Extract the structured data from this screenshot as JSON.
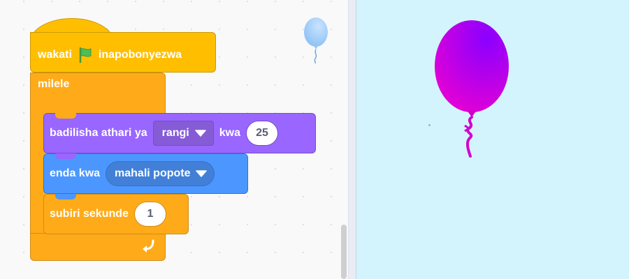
{
  "workspace": {
    "hat_block": {
      "label_before": "wakati",
      "icon": "green-flag-icon",
      "label_after": "inapobonyezwa"
    },
    "forever_block": {
      "label": "milele",
      "loop_icon": "loop-arrow-icon"
    },
    "looks_block": {
      "label_before": "badilisha athari ya",
      "effect": "rangi",
      "label_mid": "kwa",
      "value": "25"
    },
    "motion_block": {
      "label_before": "enda kwa",
      "target": "mahali popote"
    },
    "wait_block": {
      "label_before": "subiri sekunde",
      "value": "1"
    }
  },
  "sprite_thumbnail": {
    "icon": "balloon-icon"
  },
  "stage": {
    "sprite": "balloon-sprite",
    "color": "#cc00ee"
  },
  "colors": {
    "events": "#ffbf00",
    "control": "#ffab19",
    "looks": "#9966ff",
    "motion": "#4c97ff",
    "stage_background": "#d3f4fd"
  }
}
